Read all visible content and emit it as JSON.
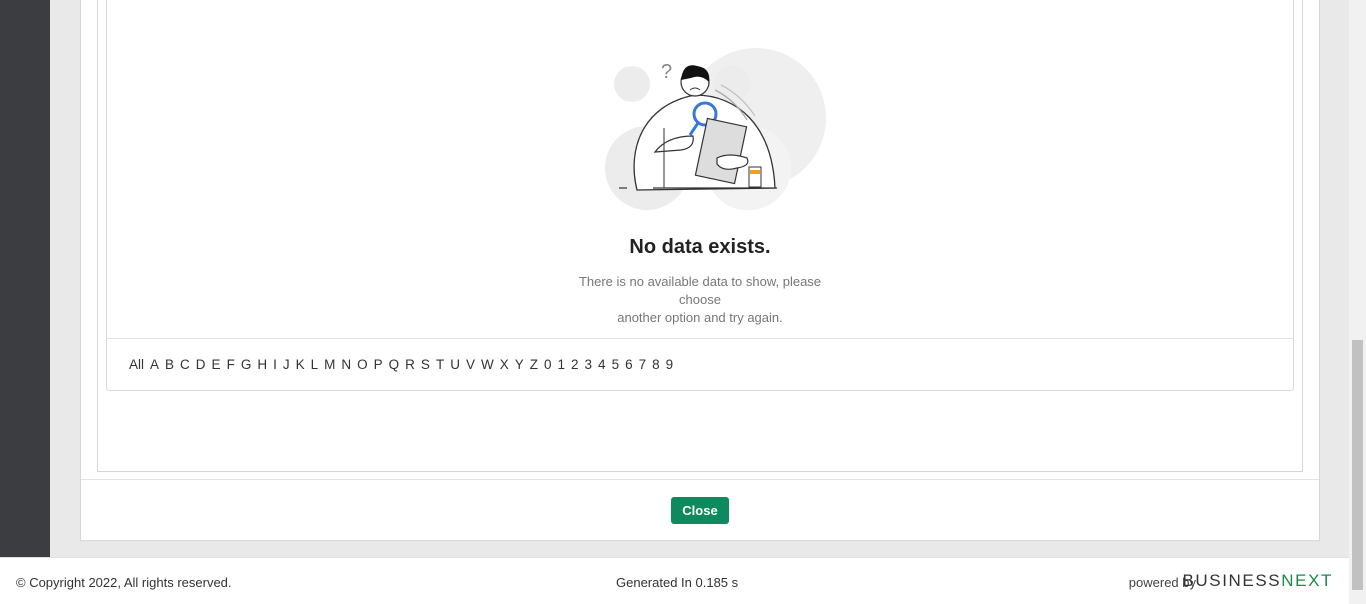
{
  "empty_state": {
    "title": "No data exists.",
    "description_line1": "There is no available data to show, please choose",
    "description_line2": "another option and try again."
  },
  "alphabet_filter": [
    "All",
    "A",
    "B",
    "C",
    "D",
    "E",
    "F",
    "G",
    "H",
    "I",
    "J",
    "K",
    "L",
    "M",
    "N",
    "O",
    "P",
    "Q",
    "R",
    "S",
    "T",
    "U",
    "V",
    "W",
    "X",
    "Y",
    "Z",
    "0",
    "1",
    "2",
    "3",
    "4",
    "5",
    "6",
    "7",
    "8",
    "9"
  ],
  "modal_footer": {
    "close_label": "Close"
  },
  "footer": {
    "copyright": "© Copyright 2022, All rights reserved.",
    "generated": "Generated In 0.185 s",
    "powered_by": "powered by",
    "brand_main": "BUSINESS",
    "brand_accent": "NEXT"
  },
  "colors": {
    "primary_button": "#0e8a5e",
    "brand_accent": "#1a8a4a",
    "left_rail": "#3c3d40"
  }
}
